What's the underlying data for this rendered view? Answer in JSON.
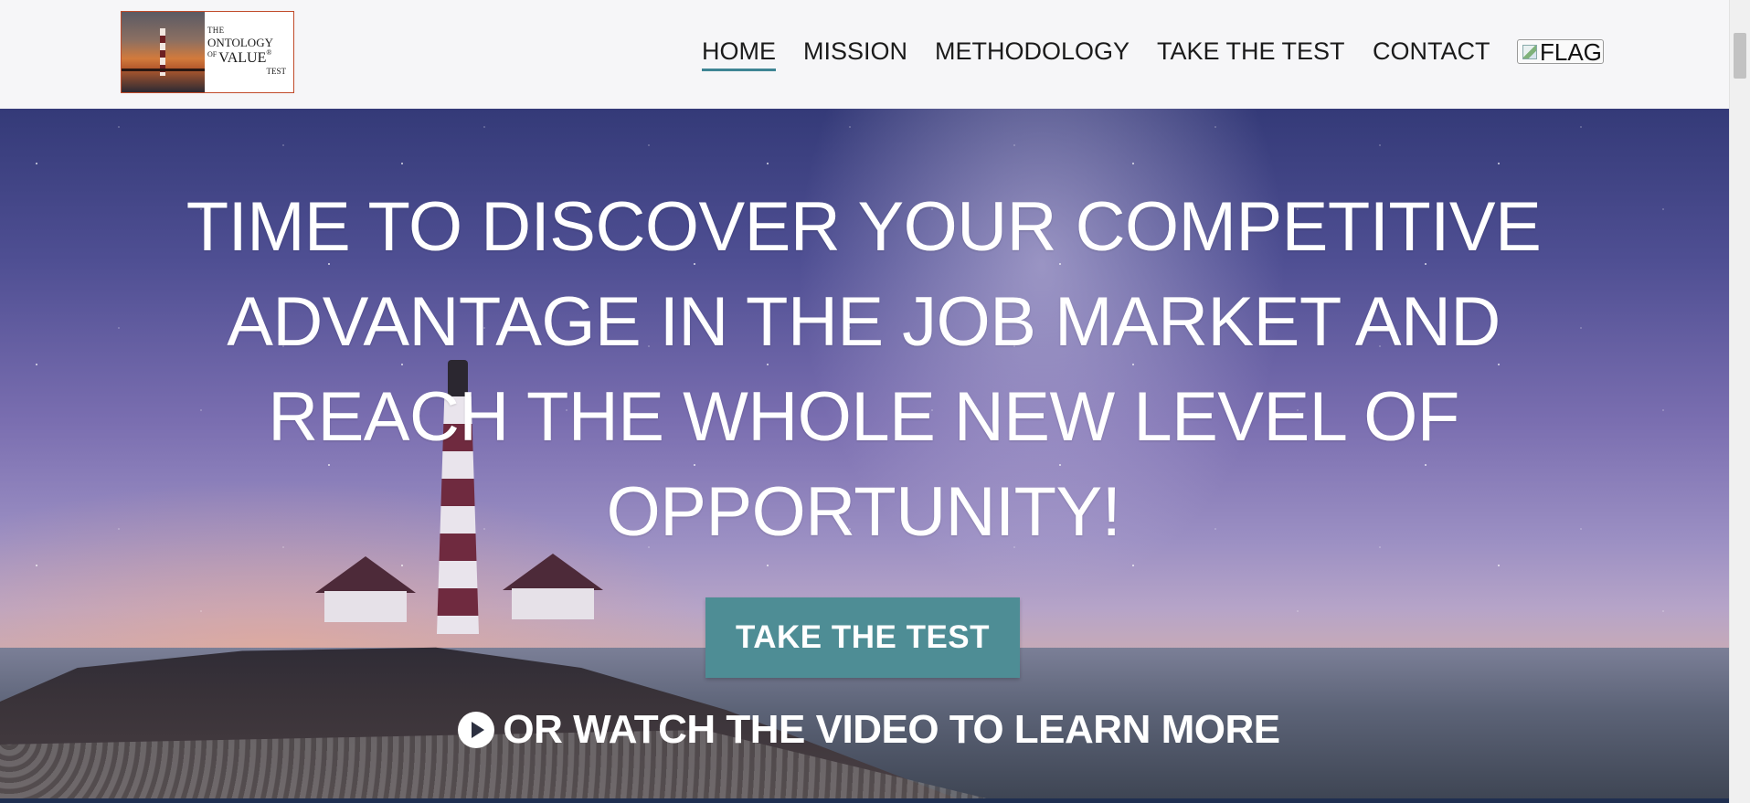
{
  "logo": {
    "line1": "THE",
    "line2": "ONTOLOGY",
    "line3_prefix": "OF",
    "line3_main": "VALUE",
    "line3_mark": "®",
    "line4": "TEST"
  },
  "nav": {
    "items": [
      {
        "label": "HOME",
        "active": true
      },
      {
        "label": "MISSION",
        "active": false
      },
      {
        "label": "METHODOLOGY",
        "active": false
      },
      {
        "label": "TAKE THE TEST",
        "active": false
      },
      {
        "label": "CONTACT",
        "active": false
      }
    ],
    "flag_alt": "FLAG"
  },
  "hero": {
    "headline_lines": [
      "TIME TO DISCOVER YOUR COMPETITIVE",
      "ADVANTAGE IN THE JOB MARKET AND",
      "REACH THE WHOLE NEW LEVEL OF",
      "OPPORTUNITY!"
    ],
    "cta_label": "TAKE THE TEST",
    "video_link": "OR WATCH THE VIDEO TO LEARN MORE"
  },
  "colors": {
    "accent": "#3f8594",
    "cta_background": "#4e8d95",
    "header_background": "#f6f6f8",
    "nav_text": "#1b1b1b",
    "hero_text": "#ffffff"
  },
  "icons": {
    "video": "play-circle-icon",
    "flag": "broken-image-icon"
  }
}
